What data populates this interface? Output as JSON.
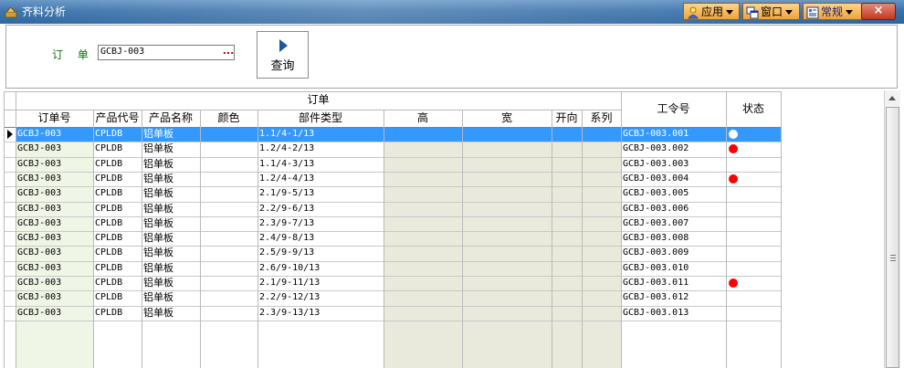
{
  "window": {
    "title": "齐料分析"
  },
  "menus": [
    {
      "label": "应用",
      "icon": "user-icon"
    },
    {
      "label": "窗口",
      "icon": "windows-icon"
    },
    {
      "label": "常规",
      "icon": "document-icon"
    }
  ],
  "close_label": "×",
  "query": {
    "order_label": "订 单 号",
    "order_value": "GCBJ-003",
    "browse_label": "...",
    "button_label": "查询"
  },
  "grid": {
    "group_header": "订单",
    "columns": [
      "订单号",
      "产品代号",
      "产品名称",
      "颜色",
      "部件类型",
      "高",
      "宽",
      "开向",
      "系列"
    ],
    "work_order_header": "工令号",
    "status_header": "状态",
    "colors": {
      "selected": "#3399ff",
      "status_red": "#ff0000",
      "status_white": "#ffffff"
    },
    "rows": [
      {
        "order": "GCBJ-003",
        "code": "CPLDB",
        "name": "铝单板",
        "color": "",
        "part": "1.1/4-1/13",
        "h": "",
        "w": "",
        "dir": "",
        "series": "",
        "work": "GCBJ-003.001",
        "status": "white",
        "selected": true
      },
      {
        "order": "GCBJ-003",
        "code": "CPLDB",
        "name": "铝单板",
        "color": "",
        "part": "1.2/4-2/13",
        "h": "",
        "w": "",
        "dir": "",
        "series": "",
        "work": "GCBJ-003.002",
        "status": "red"
      },
      {
        "order": "GCBJ-003",
        "code": "CPLDB",
        "name": "铝单板",
        "color": "",
        "part": "1.1/4-3/13",
        "h": "",
        "w": "",
        "dir": "",
        "series": "",
        "work": "GCBJ-003.003",
        "status": ""
      },
      {
        "order": "GCBJ-003",
        "code": "CPLDB",
        "name": "铝单板",
        "color": "",
        "part": "1.2/4-4/13",
        "h": "",
        "w": "",
        "dir": "",
        "series": "",
        "work": "GCBJ-003.004",
        "status": "red"
      },
      {
        "order": "GCBJ-003",
        "code": "CPLDB",
        "name": "铝单板",
        "color": "",
        "part": "2.1/9-5/13",
        "h": "",
        "w": "",
        "dir": "",
        "series": "",
        "work": "GCBJ-003.005",
        "status": ""
      },
      {
        "order": "GCBJ-003",
        "code": "CPLDB",
        "name": "铝单板",
        "color": "",
        "part": "2.2/9-6/13",
        "h": "",
        "w": "",
        "dir": "",
        "series": "",
        "work": "GCBJ-003.006",
        "status": ""
      },
      {
        "order": "GCBJ-003",
        "code": "CPLDB",
        "name": "铝单板",
        "color": "",
        "part": "2.3/9-7/13",
        "h": "",
        "w": "",
        "dir": "",
        "series": "",
        "work": "GCBJ-003.007",
        "status": ""
      },
      {
        "order": "GCBJ-003",
        "code": "CPLDB",
        "name": "铝单板",
        "color": "",
        "part": "2.4/9-8/13",
        "h": "",
        "w": "",
        "dir": "",
        "series": "",
        "work": "GCBJ-003.008",
        "status": ""
      },
      {
        "order": "GCBJ-003",
        "code": "CPLDB",
        "name": "铝单板",
        "color": "",
        "part": "2.5/9-9/13",
        "h": "",
        "w": "",
        "dir": "",
        "series": "",
        "work": "GCBJ-003.009",
        "status": ""
      },
      {
        "order": "GCBJ-003",
        "code": "CPLDB",
        "name": "铝单板",
        "color": "",
        "part": "2.6/9-10/13",
        "h": "",
        "w": "",
        "dir": "",
        "series": "",
        "work": "GCBJ-003.010",
        "status": ""
      },
      {
        "order": "GCBJ-003",
        "code": "CPLDB",
        "name": "铝单板",
        "color": "",
        "part": "2.1/9-11/13",
        "h": "",
        "w": "",
        "dir": "",
        "series": "",
        "work": "GCBJ-003.011",
        "status": "red"
      },
      {
        "order": "GCBJ-003",
        "code": "CPLDB",
        "name": "铝单板",
        "color": "",
        "part": "2.2/9-12/13",
        "h": "",
        "w": "",
        "dir": "",
        "series": "",
        "work": "GCBJ-003.012",
        "status": ""
      },
      {
        "order": "GCBJ-003",
        "code": "CPLDB",
        "name": "铝单板",
        "color": "",
        "part": "2.3/9-13/13",
        "h": "",
        "w": "",
        "dir": "",
        "series": "",
        "work": "GCBJ-003.013",
        "status": ""
      }
    ]
  }
}
